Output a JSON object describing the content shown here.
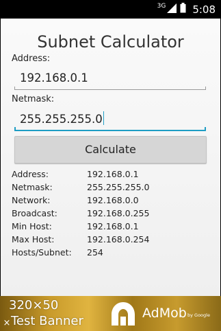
{
  "status_bar": {
    "network_type": "3G",
    "time": "5:08",
    "icons": [
      "signal-icon",
      "battery-icon"
    ]
  },
  "app": {
    "title": "Subnet Calculator",
    "address_label": "Address:",
    "address_value": "192.168.0.1",
    "netmask_label": "Netmask:",
    "netmask_value": "255.255.255.0",
    "calculate_label": "Calculate",
    "accent_color": "#1e9dc4"
  },
  "results": [
    {
      "key": "Address:",
      "value": "192.168.0.1"
    },
    {
      "key": "Netmask:",
      "value": "255.255.255.0"
    },
    {
      "key": "Network:",
      "value": "192.168.0.0"
    },
    {
      "key": "Broadcast:",
      "value": "192.168.0.255"
    },
    {
      "key": "Min Host:",
      "value": "192.168.0.1"
    },
    {
      "key": "Max Host:",
      "value": "192.168.0.254"
    },
    {
      "key": "Hosts/Subnet:",
      "value": "254"
    }
  ],
  "ad": {
    "size": "320×50",
    "label": "Test Banner",
    "brand": "AdMob",
    "by": "by Google",
    "close_symbol": "×"
  }
}
